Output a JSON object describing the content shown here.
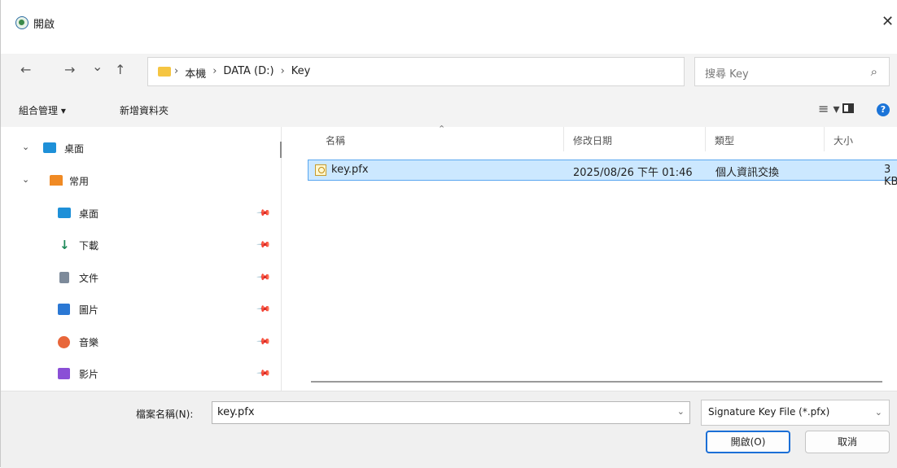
{
  "window": {
    "title": "開啟",
    "close_glyph": "✕"
  },
  "nav_buttons": {
    "back": "←",
    "forward": "→",
    "recent": "⌄",
    "up": "↑"
  },
  "address": {
    "crumbs": [
      "本機",
      "DATA (D:)",
      "Key"
    ],
    "separator": "›",
    "dropdown_glyph": "⌄",
    "refresh_glyph": "↻"
  },
  "search": {
    "placeholder": "搜尋 Key",
    "icon": "search-icon"
  },
  "toolbar": {
    "organize": "組合管理 ▾",
    "new_folder": "新增資料夾",
    "view_glyph": "≡ ▾",
    "help_glyph": "?"
  },
  "nav": {
    "items": [
      {
        "label": "桌面",
        "chevron": "⌄",
        "icon": "desktop-icon",
        "color": "#1e90d8",
        "pinned": false
      },
      {
        "label": "常用",
        "chevron": "⌄",
        "icon": "home-icon",
        "color": "#f08a24",
        "pinned": false
      },
      {
        "label": "桌面",
        "icon": "desktop-icon",
        "color": "#1e90d8",
        "pinned": true
      },
      {
        "label": "下載",
        "icon": "download-icon",
        "color": "#1e8a5a",
        "pinned": true
      },
      {
        "label": "文件",
        "icon": "document-icon",
        "color": "#7d8a9a",
        "pinned": true
      },
      {
        "label": "圖片",
        "icon": "pictures-icon",
        "color": "#2b78d4",
        "pinned": true
      },
      {
        "label": "音樂",
        "icon": "music-icon",
        "color": "#e8663a",
        "pinned": true
      },
      {
        "label": "影片",
        "icon": "videos-icon",
        "color": "#8a4fd6",
        "pinned": true
      }
    ],
    "pin_glyph": "📌"
  },
  "columns": [
    "名稱",
    "修改日期",
    "類型",
    "大小"
  ],
  "sort_glyph": "⌃",
  "files": [
    {
      "name": "key.pfx",
      "modified": "2025/08/26 下午 01:46",
      "type": "個人資訊交換",
      "size": "3 KB"
    }
  ],
  "footer": {
    "filename_label": "檔案名稱(N):",
    "filename_value": "key.pfx",
    "dropdown_glyph": "⌄",
    "filter_value": "Signature Key File (*.pfx)",
    "open_button": "開啟(O)",
    "cancel_button": "取消"
  },
  "colors": {
    "accent": "#1b6fd6",
    "selection": "#cce8ff",
    "selection_border": "#5aa7f0"
  }
}
